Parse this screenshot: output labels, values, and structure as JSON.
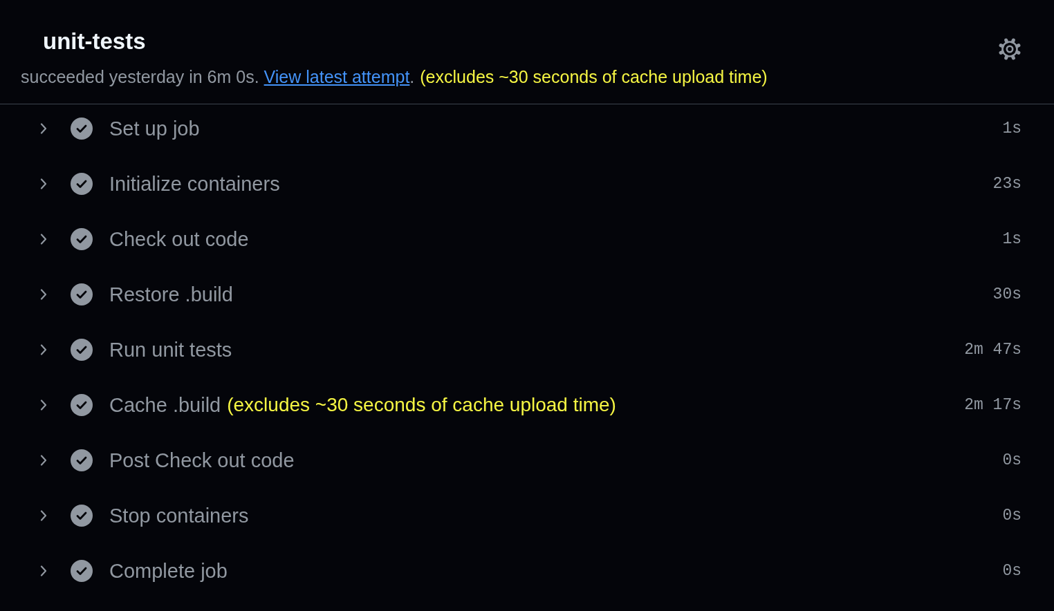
{
  "job": {
    "title": "unit-tests",
    "summary": "succeeded yesterday in 6m 0s.",
    "link": "View latest attempt",
    "link_end": ".",
    "note": "(excludes ~30 seconds of cache upload time)"
  },
  "steps": [
    {
      "name": "Set up job",
      "succeeded": true,
      "expanded": false,
      "duration": "1s"
    },
    {
      "name": "Initialize containers",
      "succeeded": true,
      "expanded": false,
      "duration": "23s"
    },
    {
      "name": "Check out code",
      "succeeded": true,
      "expanded": false,
      "duration": "1s"
    },
    {
      "name": "Restore .build",
      "succeeded": true,
      "expanded": false,
      "duration": "30s"
    },
    {
      "name": "Run unit tests",
      "succeeded": true,
      "expanded": false,
      "duration": "2m 47s"
    },
    {
      "name": "Cache .build",
      "note": "(excludes ~30 seconds of cache upload time)",
      "succeeded": true,
      "expanded": false,
      "duration": "2m 17s"
    },
    {
      "name": "Post Check out code",
      "succeeded": true,
      "expanded": false,
      "duration": "0s"
    },
    {
      "name": "Stop containers",
      "succeeded": true,
      "expanded": false,
      "duration": "0s"
    },
    {
      "name": "Complete job",
      "succeeded": true,
      "expanded": false,
      "duration": "0s"
    }
  ]
}
